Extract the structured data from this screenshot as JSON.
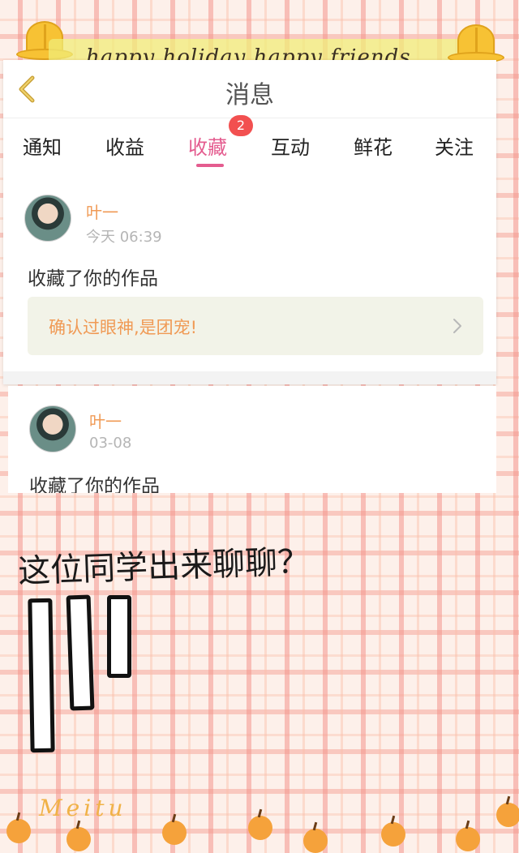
{
  "decoration": {
    "banner_text": "happy holiday happy friends",
    "watermark": "Meitu"
  },
  "header": {
    "title": "消息",
    "back_icon": "chevron-left-icon"
  },
  "tabs": [
    {
      "label": "通知",
      "active": false
    },
    {
      "label": "收益",
      "active": false
    },
    {
      "label": "收藏",
      "active": true,
      "badge": "2"
    },
    {
      "label": "互动",
      "active": false
    },
    {
      "label": "鲜花",
      "active": false
    },
    {
      "label": "关注",
      "active": false
    }
  ],
  "messages": [
    {
      "username": "叶一",
      "time": "今天 06:39",
      "text": "收藏了你的作品",
      "quote": "确认过眼神,是团宠!"
    },
    {
      "username": "叶一",
      "time": "03-08",
      "text": "收藏了你的作品"
    }
  ],
  "caption": "这位同学出来聊聊？",
  "colors": {
    "accent_pink": "#e45c8f",
    "username_orange": "#f09a55",
    "badge_red": "#f25050"
  }
}
